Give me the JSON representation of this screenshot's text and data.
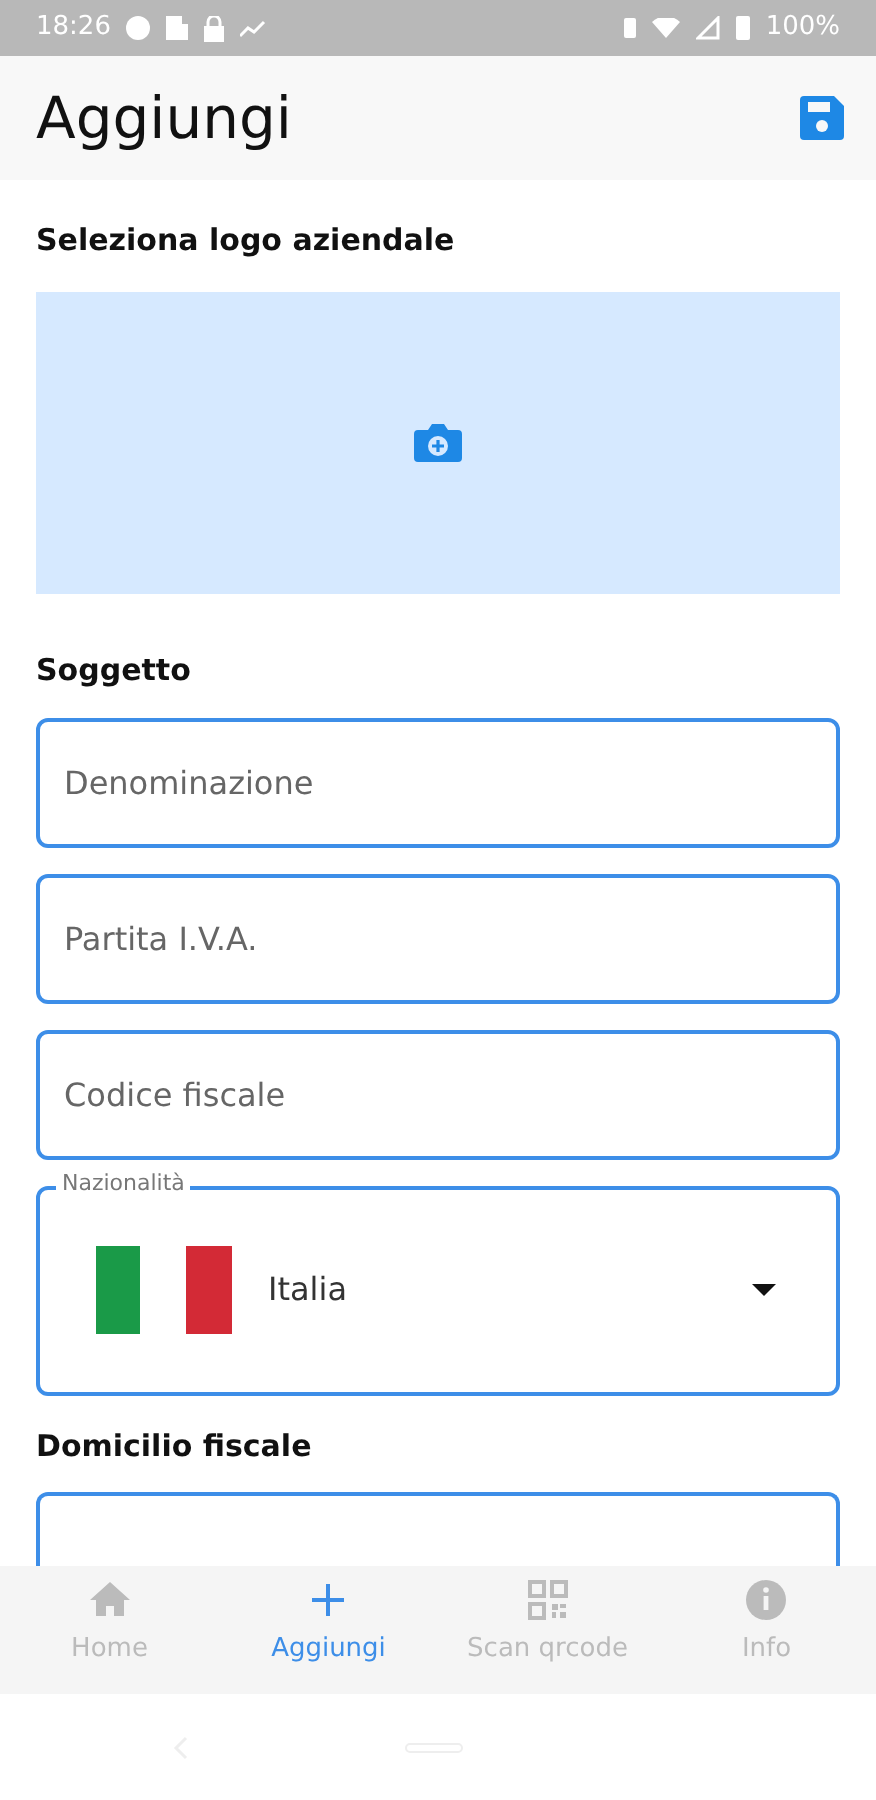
{
  "status_bar": {
    "time": "18:26",
    "battery": "100%"
  },
  "header": {
    "title": "Aggiungi"
  },
  "logo_section": {
    "label": "Seleziona logo aziendale"
  },
  "subject": {
    "label": "Soggetto",
    "fields": [
      {
        "placeholder": "Denominazione"
      },
      {
        "placeholder": "Partita I.V.A."
      },
      {
        "placeholder": "Codice fiscale"
      }
    ],
    "nationality": {
      "label": "Nazionalità",
      "value": "Italia"
    }
  },
  "domicile": {
    "label": "Domicilio fiscale"
  },
  "bottom_nav": [
    {
      "label": "Home",
      "kind": "home",
      "selected": false
    },
    {
      "label": "Aggiungi",
      "kind": "add",
      "selected": true
    },
    {
      "label": "Scan qrcode",
      "kind": "scan",
      "selected": false
    },
    {
      "label": "Info",
      "kind": "info",
      "selected": false
    }
  ]
}
